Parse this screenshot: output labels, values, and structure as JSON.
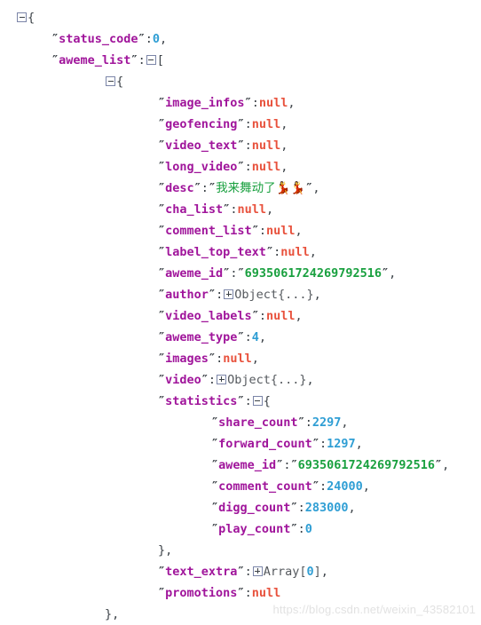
{
  "viewer": {
    "type": "json-tree-viewer",
    "colors": {
      "key": "#a0159b",
      "string": "#19a03f",
      "number": "#2f9ed4",
      "null": "#e8513c",
      "punctuation": "#3b4147",
      "background": "#ffffff",
      "watermark": "#e2e2e2"
    },
    "icons": {
      "collapse": "minus-square",
      "expand": "plus-square"
    }
  },
  "watermark": {
    "text": "https://blog.csdn.net/weixin_43582101"
  },
  "lines": [
    {
      "id": "l01",
      "indent": 0,
      "toggle": "minus",
      "brace": "{"
    },
    {
      "id": "l02",
      "indent": 1,
      "key": "status_code",
      "value": "0",
      "vtype": "number",
      "comma": true
    },
    {
      "id": "l03",
      "indent": 1,
      "key": "aweme_list",
      "toggle": "minus",
      "brace": "["
    },
    {
      "id": "l04",
      "indent": 2,
      "toggle": "minus",
      "brace": "{"
    },
    {
      "id": "l05",
      "indent": 3,
      "key": "image_infos",
      "value": "null",
      "vtype": "null",
      "comma": true
    },
    {
      "id": "l06",
      "indent": 3,
      "key": "geofencing",
      "value": "null",
      "vtype": "null",
      "comma": true
    },
    {
      "id": "l07",
      "indent": 3,
      "key": "video_text",
      "value": "null",
      "vtype": "null",
      "comma": true
    },
    {
      "id": "l08",
      "indent": 3,
      "key": "long_video",
      "value": "null",
      "vtype": "null",
      "comma": true
    },
    {
      "id": "l09",
      "indent": 3,
      "key": "desc",
      "value": "我来舞动了💃💃",
      "vtype": "string",
      "comma": true
    },
    {
      "id": "l10",
      "indent": 3,
      "key": "cha_list",
      "value": "null",
      "vtype": "null",
      "comma": true
    },
    {
      "id": "l11",
      "indent": 3,
      "key": "comment_list",
      "value": "null",
      "vtype": "null",
      "comma": true
    },
    {
      "id": "l12",
      "indent": 3,
      "key": "label_top_text",
      "value": "null",
      "vtype": "null",
      "comma": true
    },
    {
      "id": "l13",
      "indent": 3,
      "key": "aweme_id",
      "value": "6935061724269792516",
      "vtype": "string",
      "comma": true
    },
    {
      "id": "l14",
      "indent": 3,
      "key": "author",
      "value": "Object{...}",
      "vtype": "object",
      "toggle": "plus",
      "comma": true
    },
    {
      "id": "l15",
      "indent": 3,
      "key": "video_labels",
      "value": "null",
      "vtype": "null",
      "comma": true
    },
    {
      "id": "l16",
      "indent": 3,
      "key": "aweme_type",
      "value": "4",
      "vtype": "number",
      "comma": true
    },
    {
      "id": "l17",
      "indent": 3,
      "key": "images",
      "value": "null",
      "vtype": "null",
      "comma": true
    },
    {
      "id": "l18",
      "indent": 3,
      "key": "video",
      "value": "Object{...}",
      "vtype": "object",
      "toggle": "plus",
      "comma": true
    },
    {
      "id": "l19",
      "indent": 3,
      "key": "statistics",
      "toggle": "minus",
      "brace": "{"
    },
    {
      "id": "l20",
      "indent": 4,
      "key": "share_count",
      "value": "2297",
      "vtype": "number",
      "comma": true
    },
    {
      "id": "l21",
      "indent": 4,
      "key": "forward_count",
      "value": "1297",
      "vtype": "number",
      "comma": true
    },
    {
      "id": "l22",
      "indent": 4,
      "key": "aweme_id",
      "value": "6935061724269792516",
      "vtype": "string",
      "comma": true
    },
    {
      "id": "l23",
      "indent": 4,
      "key": "comment_count",
      "value": "24000",
      "vtype": "number",
      "comma": true
    },
    {
      "id": "l24",
      "indent": 4,
      "key": "digg_count",
      "value": "283000",
      "vtype": "number",
      "comma": true
    },
    {
      "id": "l25",
      "indent": 4,
      "key": "play_count",
      "value": "0",
      "vtype": "number",
      "comma": false
    },
    {
      "id": "l26",
      "indent": 3,
      "closer": "},"
    },
    {
      "id": "l27",
      "indent": 3,
      "key": "text_extra",
      "value": "Array[0]",
      "vtype": "array",
      "toggle": "plus",
      "arrayIndex": "0",
      "comma": true
    },
    {
      "id": "l28",
      "indent": 3,
      "key": "promotions",
      "value": "null",
      "vtype": "null",
      "comma": false
    },
    {
      "id": "l29",
      "indent": 2,
      "closer": "},"
    }
  ]
}
